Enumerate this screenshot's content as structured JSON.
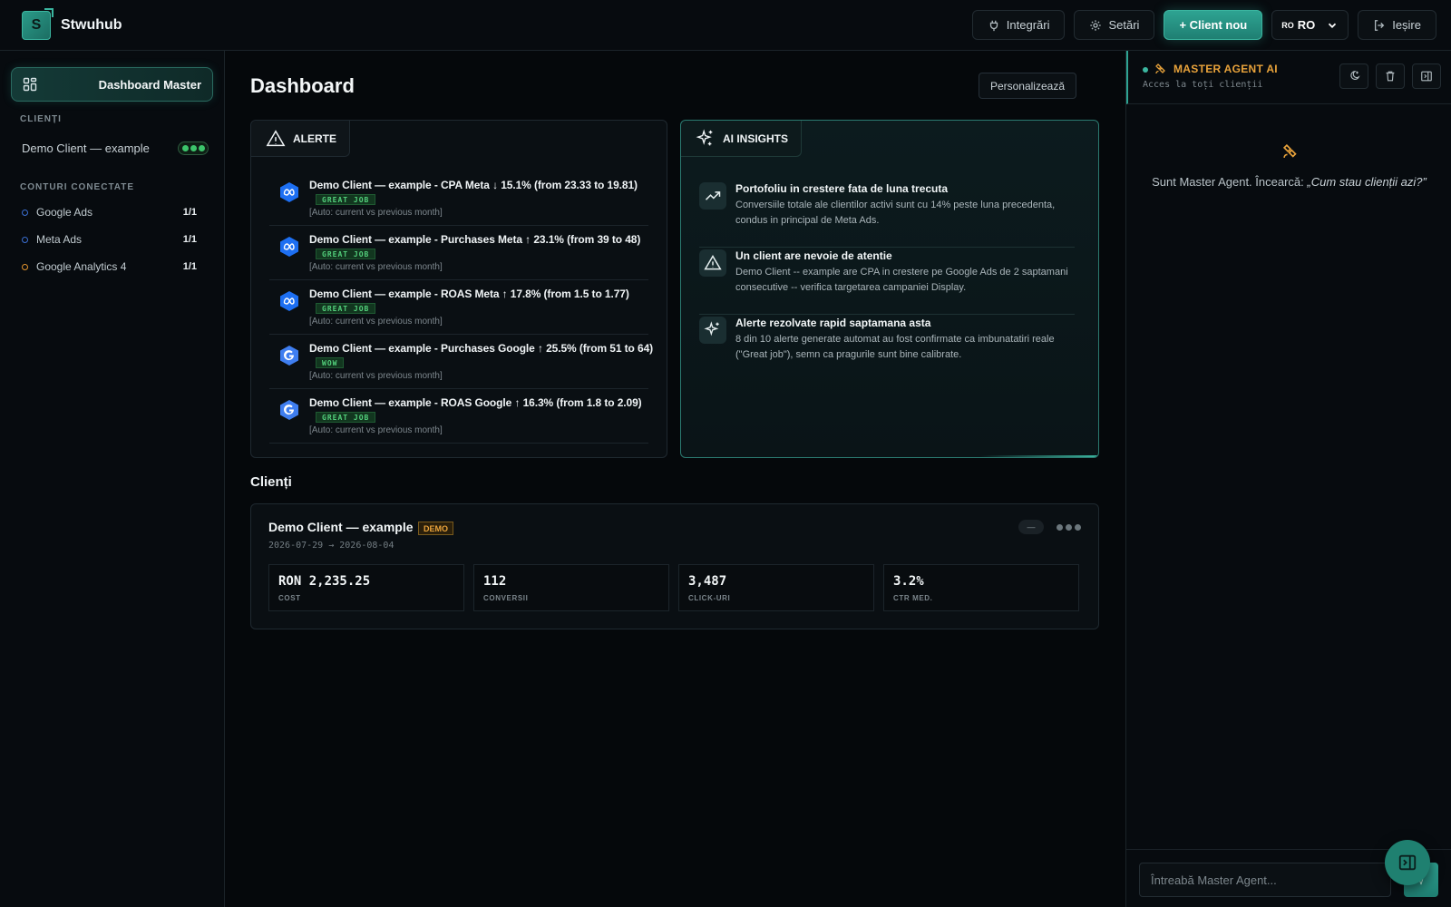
{
  "app": {
    "logo_letter": "S",
    "name": "Stwuhub"
  },
  "topbar": {
    "integrations": "Integrări",
    "settings": "Setări",
    "new_client": "+ Client nou",
    "lang_flag": "RO",
    "lang_code": "RO",
    "logout": "Ieșire"
  },
  "sidebar": {
    "dashboard": "Dashboard Master",
    "clients_heading": "CLIENȚI",
    "client_name": "Demo Client — example",
    "accounts_heading": "CONTURI CONECTATE",
    "accounts": [
      {
        "name": "Google Ads",
        "count": "1/1",
        "color": "#3b6fd2"
      },
      {
        "name": "Meta Ads",
        "count": "1/1",
        "color": "#3b6fd2"
      },
      {
        "name": "Google Analytics 4",
        "count": "1/1",
        "color": "#e3942d"
      }
    ]
  },
  "main": {
    "title": "Dashboard",
    "customize": "Personalizează",
    "alerts": {
      "label": "ALERTE",
      "items": [
        {
          "platform": "meta",
          "title": "Demo Client — example - CPA Meta ↓ 15.1% (from 23.33 to 19.81)",
          "badge": "GREAT JOB",
          "note": "[Auto: current vs previous month]"
        },
        {
          "platform": "meta",
          "title": "Demo Client — example - Purchases Meta ↑ 23.1% (from 39 to 48)",
          "badge": "GREAT JOB",
          "note": "[Auto: current vs previous month]"
        },
        {
          "platform": "meta",
          "title": "Demo Client — example - ROAS Meta ↑ 17.8% (from 1.5 to 1.77)",
          "badge": "GREAT JOB",
          "note": "[Auto: current vs previous month]"
        },
        {
          "platform": "google",
          "title": "Demo Client — example - Purchases Google ↑ 25.5% (from 51 to 64)",
          "badge": "WOW",
          "note": "[Auto: current vs previous month]"
        },
        {
          "platform": "google",
          "title": "Demo Client — example - ROAS Google ↑ 16.3% (from 1.8 to 2.09)",
          "badge": "GREAT JOB",
          "note": "[Auto: current vs previous month]"
        }
      ]
    },
    "insights": {
      "label": "AI INSIGHTS",
      "items": [
        {
          "icon": "trend-up-icon",
          "title": "Portofoliu in crestere fata de luna trecuta",
          "text": "Conversiile totale ale clientilor activi sunt cu 14% peste luna precedenta, condus in principal de Meta Ads."
        },
        {
          "icon": "warning-icon",
          "title": "Un client are nevoie de atentie",
          "text": "Demo Client -- example are CPA in crestere pe Google Ads de 2 saptamani consecutive -- verifica targetarea campaniei Display."
        },
        {
          "icon": "sparkle-icon",
          "title": "Alerte rezolvate rapid saptamana asta",
          "text": "8 din 10 alerte generate automat au fost confirmate ca imbunatatiri reale (\"Great job\"), semn ca pragurile sunt bine calibrate."
        }
      ]
    },
    "clients_title": "Clienți",
    "client_card": {
      "name": "Demo Client — example",
      "badge": "DEMO",
      "date_range": "2026-07-29 → 2026-08-04",
      "pill": "—",
      "metrics": [
        {
          "value": "RON 2,235.25",
          "label": "COST"
        },
        {
          "value": "112",
          "label": "CONVERSII"
        },
        {
          "value": "3,487",
          "label": "CLICK-URI"
        },
        {
          "value": "3.2%",
          "label": "CTR MED."
        }
      ]
    }
  },
  "agent": {
    "title": "MASTER AGENT AI",
    "subtitle": "Acces la toți clienții",
    "message_intro": "Sunt Master Agent. Încearcă: ",
    "message_example": "„Cum stau clienții azi?”",
    "input_placeholder": "Întreabă Master Agent...",
    "send_glyph": "√"
  },
  "colors": {
    "accent": "#2ea392",
    "agent_title": "#e9a33b",
    "badge_green": "#53d07c"
  }
}
